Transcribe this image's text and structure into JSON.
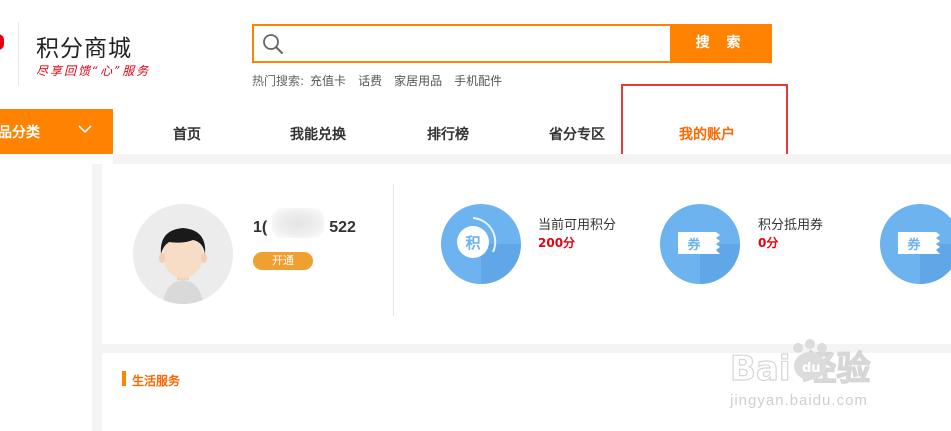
{
  "brand": {
    "title": "积分商城",
    "slogan": "尽享回馈“心”服务"
  },
  "search": {
    "placeholder": "",
    "value": "",
    "button_label": "搜 索"
  },
  "hot_search": {
    "label": "热门搜索:",
    "links": [
      "充值卡",
      "话费",
      "家居用品",
      "手机配件"
    ]
  },
  "nav": {
    "category_label": "品分类",
    "items": [
      "首页",
      "我能兑换",
      "排行榜",
      "省分专区",
      "我的账户"
    ],
    "active_index": 4
  },
  "account": {
    "user_id_prefix": "1(",
    "user_id_suffix": "522",
    "activate_label": "开通"
  },
  "stats": [
    {
      "label": "当前可用积分",
      "value": "200分",
      "icon_char": "积",
      "icon": "points-icon"
    },
    {
      "label": "积分抵用券",
      "value": "0分",
      "icon_char": "券",
      "icon": "coupon-icon"
    },
    {
      "label": "",
      "value": "",
      "icon_char": "券",
      "icon": "coupon-icon"
    }
  ],
  "life_service": {
    "title": "生活服务"
  },
  "watermark": {
    "brand_text": "Bai  经验",
    "paw_text": "du",
    "url": "jingyan.baidu.com"
  },
  "colors": {
    "accent": "#ff8200",
    "active_nav": "#ff6600",
    "price_red": "#e60012",
    "stat_blue": "#6cb3f0",
    "highlight_box": "#e03c3c"
  }
}
